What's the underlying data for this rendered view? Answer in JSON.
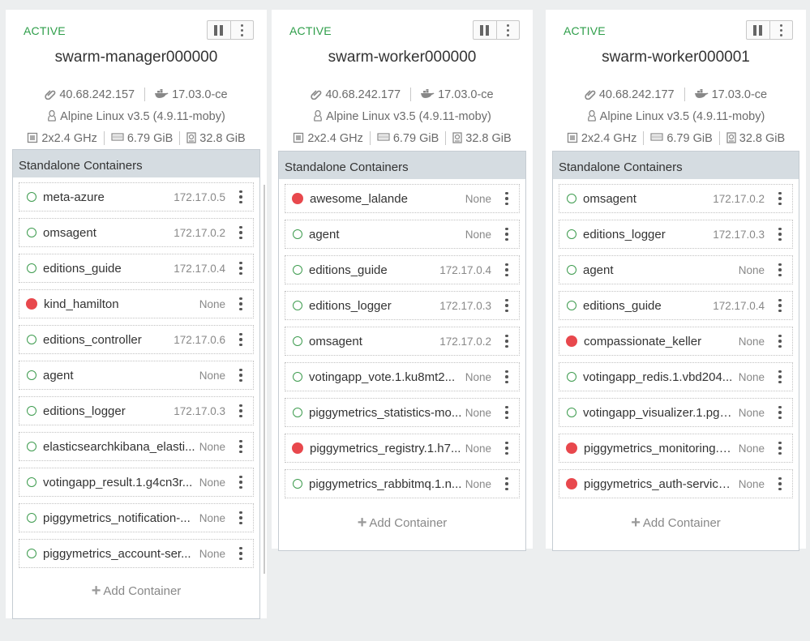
{
  "nodes": [
    {
      "status": "ACTIVE",
      "hostname": "swarm-manager000000",
      "ip": "40.68.242.157",
      "docker_version": "17.03.0-ce",
      "os": "Alpine Linux v3.5 (4.9.11-moby)",
      "cpu": "2x2.4 GHz",
      "memory": "6.79 GiB",
      "disk": "32.8 GiB",
      "section_title": "Standalone Containers",
      "add_label": "Add Container",
      "containers": [
        {
          "name": "meta-azure",
          "ip": "172.17.0.5",
          "state": "running"
        },
        {
          "name": "omsagent",
          "ip": "172.17.0.2",
          "state": "running"
        },
        {
          "name": "editions_guide",
          "ip": "172.17.0.4",
          "state": "running"
        },
        {
          "name": "kind_hamilton",
          "ip": "None",
          "state": "stopped"
        },
        {
          "name": "editions_controller",
          "ip": "172.17.0.6",
          "state": "running"
        },
        {
          "name": "agent",
          "ip": "None",
          "state": "running"
        },
        {
          "name": "editions_logger",
          "ip": "172.17.0.3",
          "state": "running"
        },
        {
          "name": "elasticsearchkibana_elasti...",
          "ip": "None",
          "state": "running"
        },
        {
          "name": "votingapp_result.1.g4cn3r...",
          "ip": "None",
          "state": "running"
        },
        {
          "name": "piggymetrics_notification-...",
          "ip": "None",
          "state": "running"
        },
        {
          "name": "piggymetrics_account-ser...",
          "ip": "None",
          "state": "running"
        }
      ]
    },
    {
      "status": "ACTIVE",
      "hostname": "swarm-worker000000",
      "ip": "40.68.242.177",
      "docker_version": "17.03.0-ce",
      "os": "Alpine Linux v3.5 (4.9.11-moby)",
      "cpu": "2x2.4 GHz",
      "memory": "6.79 GiB",
      "disk": "32.8 GiB",
      "section_title": "Standalone Containers",
      "add_label": "Add Container",
      "containers": [
        {
          "name": "awesome_lalande",
          "ip": "None",
          "state": "stopped"
        },
        {
          "name": "agent",
          "ip": "None",
          "state": "running"
        },
        {
          "name": "editions_guide",
          "ip": "172.17.0.4",
          "state": "running"
        },
        {
          "name": "editions_logger",
          "ip": "172.17.0.3",
          "state": "running"
        },
        {
          "name": "omsagent",
          "ip": "172.17.0.2",
          "state": "running"
        },
        {
          "name": "votingapp_vote.1.ku8mt2...",
          "ip": "None",
          "state": "running"
        },
        {
          "name": "piggymetrics_statistics-mo...",
          "ip": "None",
          "state": "running"
        },
        {
          "name": "piggymetrics_registry.1.h7...",
          "ip": "None",
          "state": "stopped"
        },
        {
          "name": "piggymetrics_rabbitmq.1.n...",
          "ip": "None",
          "state": "running"
        }
      ]
    },
    {
      "status": "ACTIVE",
      "hostname": "swarm-worker000001",
      "ip": "40.68.242.177",
      "docker_version": "17.03.0-ce",
      "os": "Alpine Linux v3.5 (4.9.11-moby)",
      "cpu": "2x2.4 GHz",
      "memory": "6.79 GiB",
      "disk": "32.8 GiB",
      "section_title": "Standalone Containers",
      "add_label": "Add Container",
      "containers": [
        {
          "name": "omsagent",
          "ip": "172.17.0.2",
          "state": "running"
        },
        {
          "name": "editions_logger",
          "ip": "172.17.0.3",
          "state": "running"
        },
        {
          "name": "agent",
          "ip": "None",
          "state": "running"
        },
        {
          "name": "editions_guide",
          "ip": "172.17.0.4",
          "state": "running"
        },
        {
          "name": "compassionate_keller",
          "ip": "None",
          "state": "stopped"
        },
        {
          "name": "votingapp_redis.1.vbd204...",
          "ip": "None",
          "state": "running"
        },
        {
          "name": "votingapp_visualizer.1.pg7...",
          "ip": "None",
          "state": "running"
        },
        {
          "name": "piggymetrics_monitoring.1...",
          "ip": "None",
          "state": "stopped"
        },
        {
          "name": "piggymetrics_auth-service...",
          "ip": "None",
          "state": "stopped"
        }
      ]
    }
  ],
  "colors": {
    "active": "#2e9e49",
    "running": "#3d9b4e",
    "stopped": "#e8484d",
    "section_header": "#d5dce1"
  },
  "icons": {
    "ip": "paperclip-icon",
    "docker": "docker-whale-icon",
    "os": "linux-penguin-icon",
    "cpu": "cpu-chip-icon",
    "memory": "memory-icon",
    "disk": "disk-icon",
    "pause": "pause-icon",
    "menu": "kebab-menu-icon",
    "add": "plus-icon"
  }
}
